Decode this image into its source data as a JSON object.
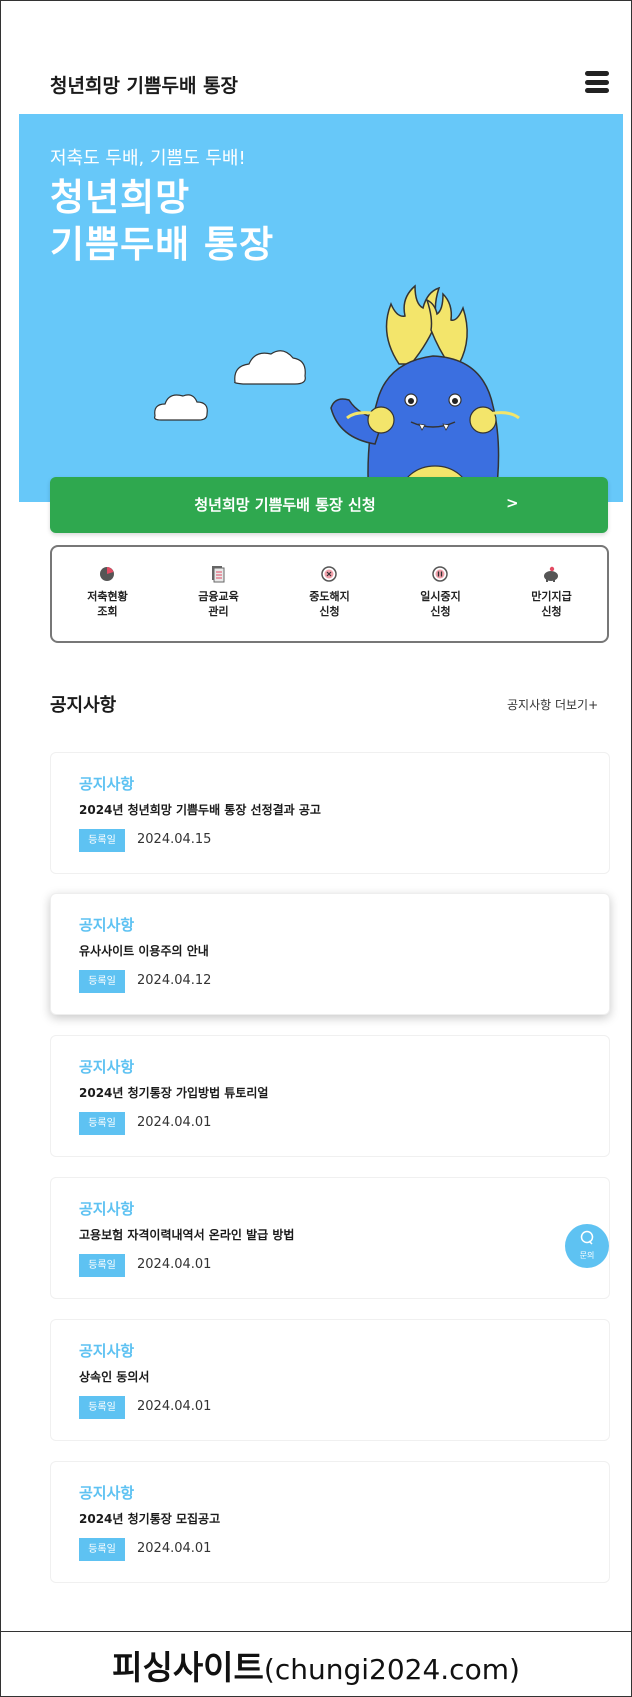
{
  "app_title": "청년희망 기쁨두배 통장",
  "hero": {
    "subtitle": "저축도 두배, 기쁨도 두배!",
    "title": "청년희망\n기쁨두배 통장",
    "background_color": "#67c8f9"
  },
  "apply_button": {
    "label": "청년희망 기쁨두배 통장 신청",
    "arrow": ">",
    "color": "#2fa84f"
  },
  "quick_menu": [
    {
      "label": "저축현황\n조회",
      "icon": "pie-chart-icon"
    },
    {
      "label": "금융교육\n관리",
      "icon": "document-icon"
    },
    {
      "label": "중도해지\n신청",
      "icon": "cancel-circle-icon"
    },
    {
      "label": "일시중지\n신청",
      "icon": "pause-circle-icon"
    },
    {
      "label": "만기지급\n신청",
      "icon": "piggy-bank-icon"
    }
  ],
  "notices": {
    "section_title": "공지사항",
    "more_link": "공지사항 더보기+",
    "items": [
      {
        "category": "공지사항",
        "title": "2024년 청년희망 기쁨두배 통장 선정결과 공고",
        "badge": "등록일",
        "date": "2024.04.15"
      },
      {
        "category": "공지사항",
        "title": "유사사이트 이용주의 안내",
        "badge": "등록일",
        "date": "2024.04.12"
      },
      {
        "category": "공지사항",
        "title": "2024년 청기통장 가입방법 튜토리얼",
        "badge": "등록일",
        "date": "2024.04.01"
      },
      {
        "category": "공지사항",
        "title": "고용보험 자격이력내역서 온라인 발급 방법",
        "badge": "등록일",
        "date": "2024.04.01"
      },
      {
        "category": "공지사항",
        "title": "상속인 동의서",
        "badge": "등록일",
        "date": "2024.04.01"
      },
      {
        "category": "공지사항",
        "title": "2024년 청기통장 모집공고",
        "badge": "등록일",
        "date": "2024.04.01"
      }
    ]
  },
  "chat": {
    "label": "문의",
    "icon": "chat-bubble-icon"
  },
  "caption": {
    "main": "피싱사이트",
    "sub": "(chungi2024.com)"
  },
  "colors": {
    "accent": "#5ec2f2",
    "green": "#2fa84f"
  }
}
